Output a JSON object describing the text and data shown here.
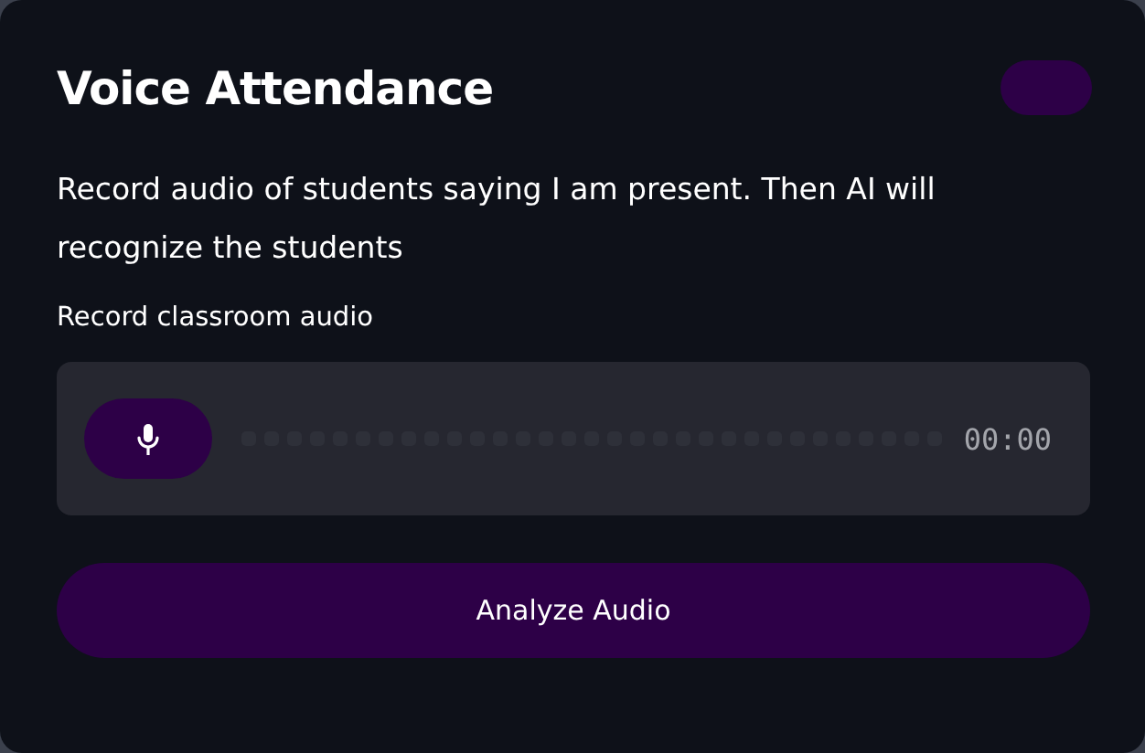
{
  "title": "Voice Attendance",
  "description": "Record audio of students saying I am present. Then AI will recognize the students",
  "recorder": {
    "label": "Record classroom audio",
    "recording": false,
    "time": "00:00"
  },
  "buttons": [
    "Analyze Audio"
  ]
}
